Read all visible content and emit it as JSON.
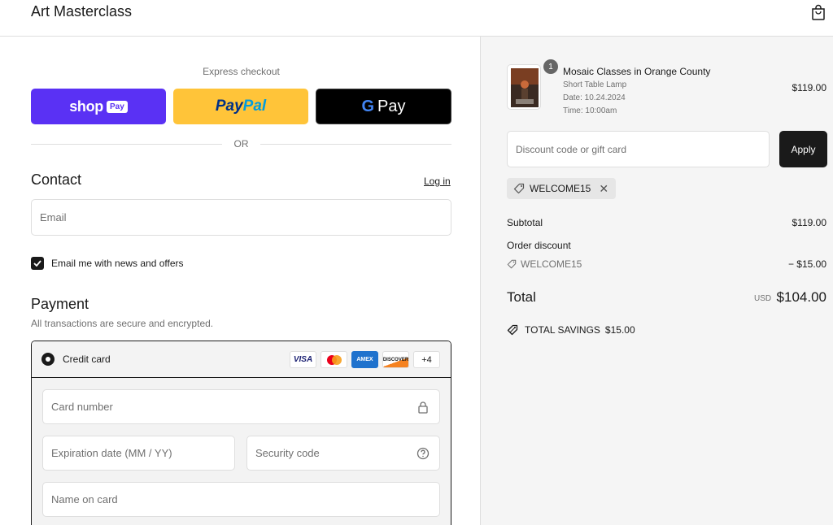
{
  "header": {
    "brand": "Art Masterclass",
    "cart_icon": "shopping-bag-icon"
  },
  "express": {
    "label": "Express checkout",
    "shop_pay": {
      "word": "shop",
      "badge": "Pay"
    },
    "paypal": {
      "part1": "Pay",
      "part2": "Pal"
    },
    "gpay": {
      "g": "G",
      "word": "Pay"
    },
    "or_label": "OR"
  },
  "contact": {
    "title": "Contact",
    "login_label": "Log in",
    "email_placeholder": "Email",
    "newsletter_label": "Email me with news and offers",
    "newsletter_checked": true
  },
  "payment": {
    "title": "Payment",
    "subtitle": "All transactions are secure and encrypted.",
    "method_label": "Credit card",
    "card_brands": [
      "VISA",
      "MC",
      "AMEX",
      "DISCOVER"
    ],
    "more_brands": "+4",
    "card_number_placeholder": "Card number",
    "expiry_placeholder": "Expiration date (MM / YY)",
    "security_placeholder": "Security code",
    "name_placeholder": "Name on card"
  },
  "summary": {
    "item": {
      "quantity": "1",
      "title": "Mosaic Classes in Orange County",
      "variant": "Short Table Lamp",
      "date": "Date: 10.24.2024",
      "time": "Time: 10:00am",
      "price": "$119.00"
    },
    "discount_placeholder": "Discount code or gift card",
    "apply_label": "Apply",
    "applied_code": "WELCOME15",
    "subtotal_label": "Subtotal",
    "subtotal_value": "$119.00",
    "order_discount_label": "Order discount",
    "discount_code": "WELCOME15",
    "discount_value": "− $15.00",
    "total_label": "Total",
    "currency": "USD",
    "total_value": "$104.00",
    "savings_label": "TOTAL SAVINGS",
    "savings_value": "$15.00"
  },
  "colors": {
    "shop_pay": "#5a31f4",
    "paypal": "#ffc439",
    "gpay": "#000000",
    "accent": "#1a1a1a",
    "summary_bg": "#f5f5f5"
  }
}
